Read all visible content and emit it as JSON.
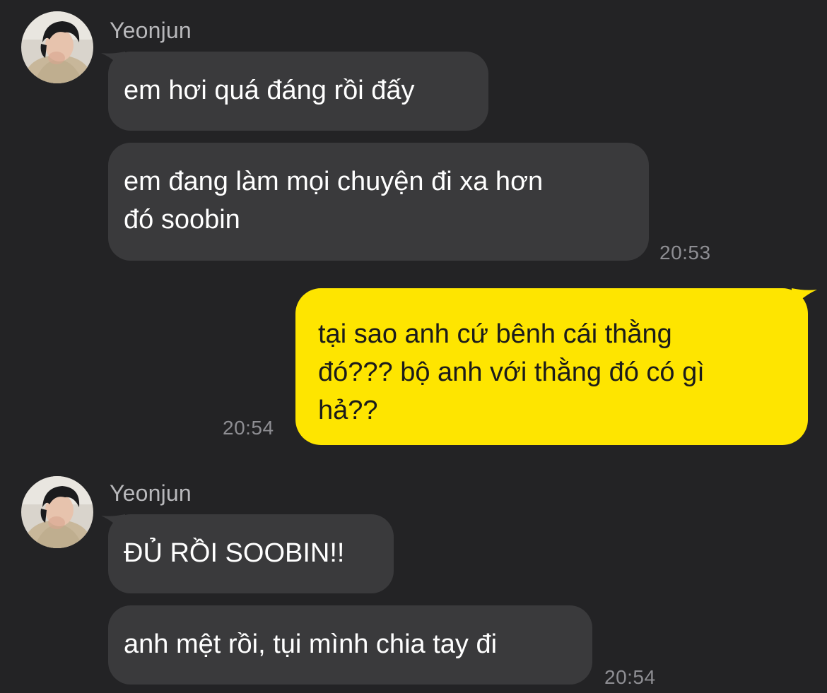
{
  "colors": {
    "background": "#232325",
    "incoming_bubble": "#3a3a3c",
    "outgoing_bubble": "#fee500",
    "timestamp": "#8e8e93",
    "sender_name": "#b8b8bb"
  },
  "messages": [
    {
      "sender": "Yeonjun",
      "avatar_icon": "profile-photo",
      "bubbles": [
        {
          "lines": [
            "em hơi quá đáng rồi đấy"
          ]
        },
        {
          "lines": [
            "em đang làm mọi chuyện đi xa hơn",
            "đó soobin"
          ]
        }
      ],
      "time": "20:53"
    },
    {
      "sender": "me",
      "bubbles": [
        {
          "lines": [
            "tại sao anh cứ bênh cái thằng",
            "đó??? bộ anh với thằng đó có gì",
            "hả??"
          ]
        }
      ],
      "time": "20:54"
    },
    {
      "sender": "Yeonjun",
      "avatar_icon": "profile-photo",
      "bubbles": [
        {
          "lines": [
            "ĐỦ RỒI SOOBIN!!"
          ]
        },
        {
          "lines": [
            "anh mệt rồi, tụi mình chia tay đi"
          ]
        }
      ],
      "time": "20:54"
    }
  ]
}
